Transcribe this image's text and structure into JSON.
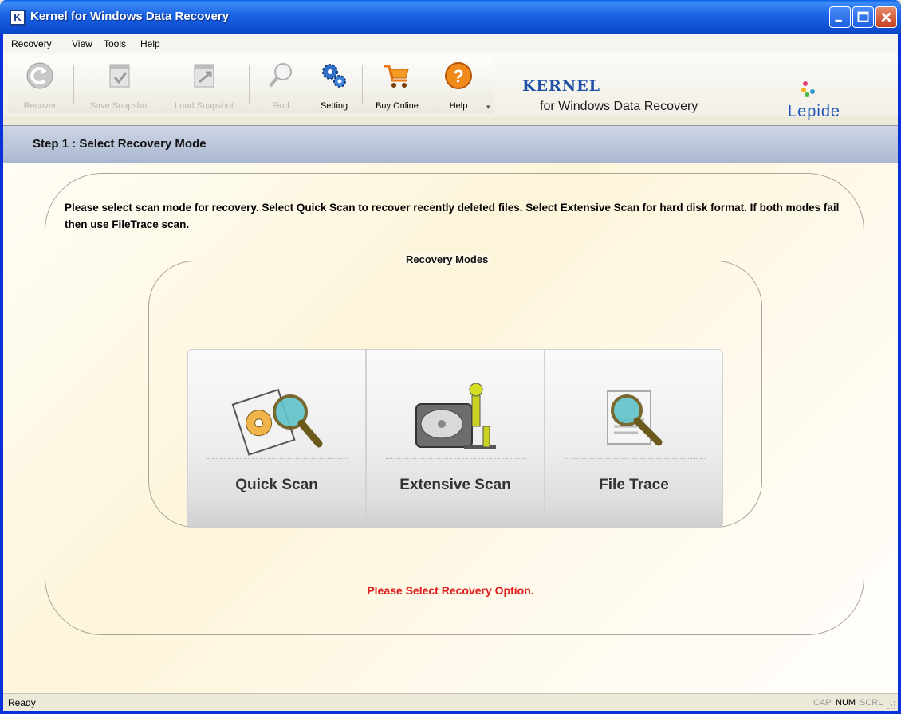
{
  "window": {
    "title": "Kernel for Windows Data Recovery",
    "app_icon_letter": "K"
  },
  "menu": {
    "items": [
      "Recovery",
      "View",
      "Tools",
      "Help"
    ]
  },
  "toolbar": {
    "buttons": [
      {
        "label": "Recover",
        "icon": "recover-icon",
        "enabled": false
      },
      {
        "label": "Save Snapshot",
        "icon": "save-snapshot-icon",
        "enabled": false
      },
      {
        "label": "Load Snapshot",
        "icon": "load-snapshot-icon",
        "enabled": false
      },
      {
        "label": "Find",
        "icon": "magnifier-icon",
        "enabled": false
      },
      {
        "label": "Setting",
        "icon": "gears-icon",
        "enabled": true
      },
      {
        "label": "Buy Online",
        "icon": "shopping-cart-icon",
        "enabled": true
      },
      {
        "label": "Help",
        "icon": "help-icon",
        "enabled": true
      }
    ]
  },
  "branding": {
    "kernel": "KERNEL",
    "subtitle": "for Windows Data Recovery",
    "vendor": "Lepide"
  },
  "step": {
    "title": "Step 1 : Select Recovery Mode"
  },
  "instruction": "Please select scan mode for recovery. Select Quick Scan to recover recently deleted files. Select Extensive Scan for hard disk format. If both modes fail then use FileTrace scan.",
  "recovery_modes": {
    "legend": "Recovery Modes",
    "options": [
      {
        "label": "Quick Scan",
        "icon": "quick-scan-icon"
      },
      {
        "label": "Extensive Scan",
        "icon": "extensive-scan-icon"
      },
      {
        "label": "File Trace",
        "icon": "file-trace-icon"
      }
    ]
  },
  "message": "Please Select Recovery Option.",
  "status": {
    "text": "Ready",
    "cap": "CAP",
    "num": "NUM",
    "scrl": "SCRL"
  },
  "colors": {
    "title_bar": "#0a5fe8",
    "message": "#e11a1a",
    "brand": "#1d4fa6"
  }
}
